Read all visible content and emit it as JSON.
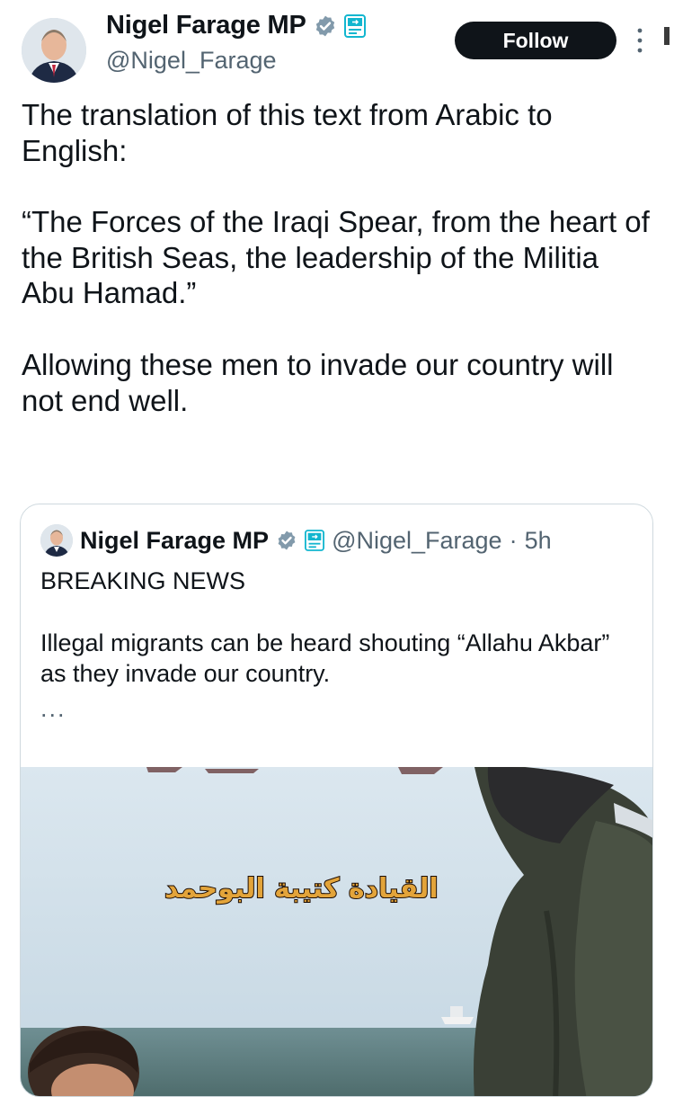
{
  "tweet": {
    "author_name": "Nigel Farage MP",
    "handle": "@Nigel_Farage",
    "follow_label": "Follow",
    "paragraphs": [
      "The translation of this text from Arabic to English:",
      "“The Forces of the Iraqi Spear, from the heart of the British Seas, the leadership of the Militia Abu Hamad.”",
      "Allowing these men to invade our country will not end well."
    ]
  },
  "quoted": {
    "author_name": "Nigel Farage MP",
    "handle": "@Nigel_Farage",
    "separator": "·",
    "time": "5h",
    "headline": "BREAKING NEWS",
    "body": "Illegal migrants can be heard shouting “Allahu Akbar” as they invade our country.",
    "ellipsis": "...",
    "video_overlay_text": "القيادة كتيبة البوحمد"
  },
  "colors": {
    "verified": "#829aab",
    "reform_badge": "#12b6cf",
    "follow_bg": "#0f1419",
    "secondary_text": "#536471",
    "overlay_text": "#e3a43a"
  },
  "icons": {
    "verified": "verified-badge-icon",
    "affiliate": "reform-uk-badge-icon",
    "more": "more-vertical-icon"
  }
}
